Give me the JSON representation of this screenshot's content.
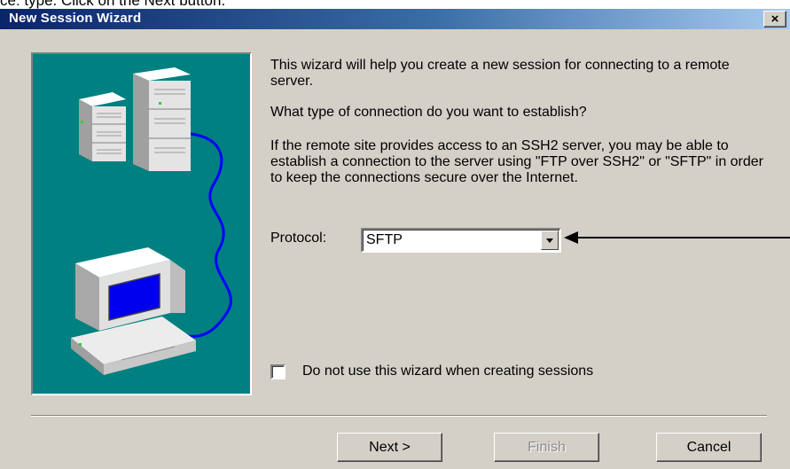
{
  "page": {
    "caption": "ce: type. Click on the Next button."
  },
  "dialog": {
    "title": "New Session Wizard",
    "close_label": "×",
    "intro_text": "This wizard will help you create a new session for connecting to a remote server.",
    "question_text": "What type of connection do you want to establish?",
    "info_text": "If the remote site provides access to an SSH2 server, you may be able to establish a connection to the server using \"FTP over SSH2\" or \"SFTP\" in order to keep the connections secure over the Internet.",
    "protocol": {
      "label": "Protocol:",
      "selected": "SFTP"
    },
    "checkbox": {
      "label": "Do not use this wizard when creating sessions",
      "checked": false
    },
    "buttons": {
      "next": "Next >",
      "finish": "Finish",
      "cancel": "Cancel"
    }
  },
  "colors": {
    "title_bar_start": "#0a246a",
    "dialog_bg": "#d4d0c8",
    "illustration_bg": "#008080",
    "cable": "#0000ff",
    "disabled_text": "#8c8c8c"
  }
}
